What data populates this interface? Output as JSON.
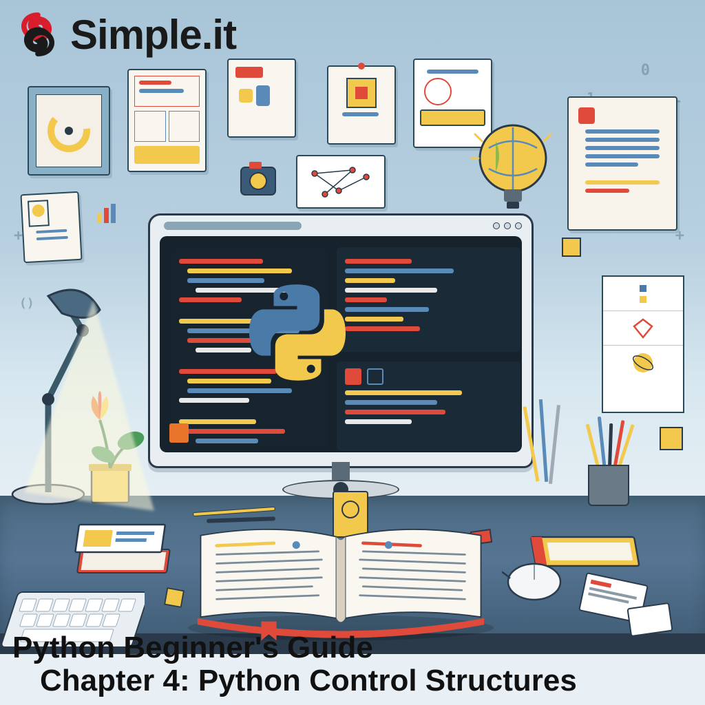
{
  "brand": {
    "name": "Simple.it",
    "logo_color_primary": "#d81e2c",
    "logo_color_secondary": "#1a1a1a"
  },
  "footer": {
    "line1": "Python Beginner's Guide",
    "line2": "Chapter 4: Python Control Structures"
  },
  "colors": {
    "accent_red": "#e04a3a",
    "accent_yellow": "#f4c430",
    "accent_blue": "#5a8ab8",
    "code_bg": "#16222c",
    "python_blue": "#4a7aa8",
    "python_yellow": "#f2c94c"
  },
  "decorative_symbols": [
    "0",
    "1",
    "0",
    "+",
    "()",
    "+"
  ]
}
